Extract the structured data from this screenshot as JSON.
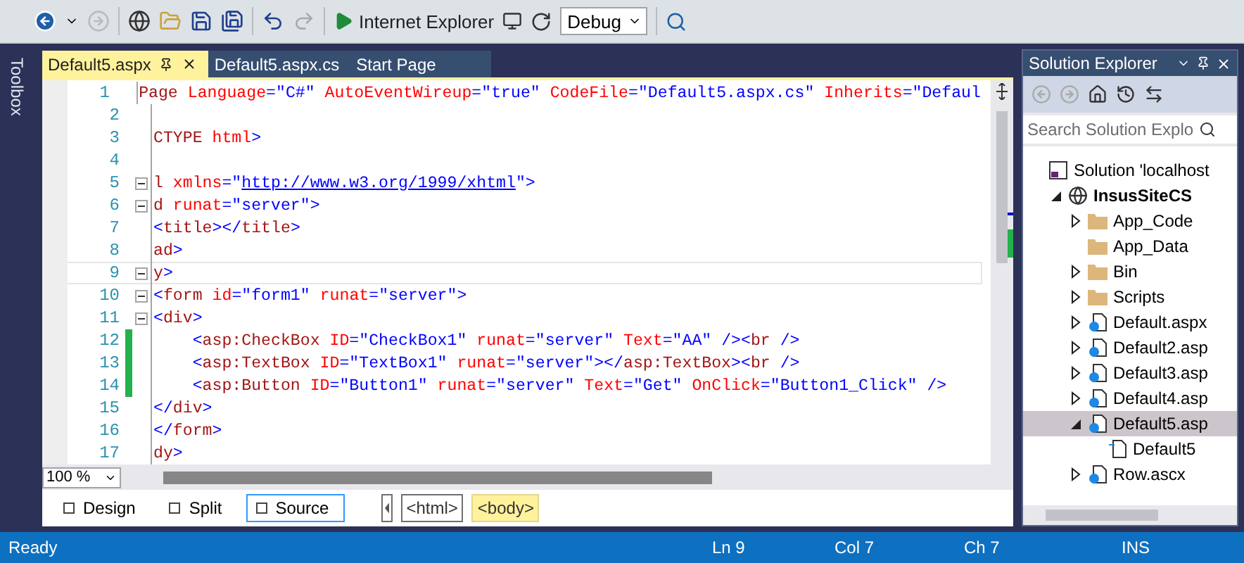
{
  "toolbar": {
    "browser": "Internet Explorer",
    "configuration": "Debug"
  },
  "toolbox": {
    "label": "Toolbox"
  },
  "tabs": [
    {
      "label": "Default5.aspx",
      "selected": true
    },
    {
      "label": "Default5.aspx.cs",
      "selected": false
    },
    {
      "label": "Start Page",
      "selected": false
    }
  ],
  "editor": {
    "zoom": "100 %",
    "lines": [
      {
        "number": "1",
        "fold": false,
        "changed": false,
        "current": false,
        "tokens": [
          {
            "kind": "tag",
            "text": "Page"
          },
          {
            "kind": "attr",
            "text": " Language"
          },
          {
            "kind": "value",
            "text": "=\"C#\""
          },
          {
            "kind": "attr",
            "text": " AutoEventWireup"
          },
          {
            "kind": "value",
            "text": "=\"true\""
          },
          {
            "kind": "attr",
            "text": " CodeFile"
          },
          {
            "kind": "value",
            "text": "=\"Default5.aspx.cs\""
          },
          {
            "kind": "attr",
            "text": " Inherits"
          },
          {
            "kind": "value",
            "text": "=\"Defaul"
          }
        ]
      },
      {
        "number": "2",
        "fold": false,
        "changed": false,
        "current": false
      },
      {
        "number": "3",
        "fold": false,
        "changed": false,
        "current": false,
        "tokens": [
          {
            "kind": "tag",
            "text": "CTYPE"
          },
          {
            "kind": "attr",
            "text": " html"
          },
          {
            "kind": "punct",
            "text": ">"
          }
        ]
      },
      {
        "number": "4",
        "fold": false,
        "changed": false,
        "current": false
      },
      {
        "number": "5",
        "fold": true,
        "changed": false,
        "current": false,
        "tokens": [
          {
            "kind": "tag",
            "text": "l"
          },
          {
            "kind": "attr",
            "text": " xmlns"
          },
          {
            "kind": "value",
            "text": "=\""
          },
          {
            "kind": "link",
            "text": "http://www.w3.org/1999/xhtml"
          },
          {
            "kind": "value",
            "text": "\">"
          }
        ]
      },
      {
        "number": "6",
        "fold": true,
        "changed": false,
        "current": false,
        "tokens": [
          {
            "kind": "tag",
            "text": "d"
          },
          {
            "kind": "attr",
            "text": " runat"
          },
          {
            "kind": "value",
            "text": "=\"server\">"
          }
        ]
      },
      {
        "number": "7",
        "fold": false,
        "changed": false,
        "current": false,
        "tokens": [
          {
            "kind": "punct",
            "text": "<"
          },
          {
            "kind": "tag",
            "text": "title"
          },
          {
            "kind": "punct",
            "text": "></"
          },
          {
            "kind": "tag",
            "text": "title"
          },
          {
            "kind": "punct",
            "text": ">"
          }
        ]
      },
      {
        "number": "8",
        "fold": false,
        "changed": false,
        "current": false,
        "tokens": [
          {
            "kind": "tag",
            "text": "ad"
          },
          {
            "kind": "punct",
            "text": ">"
          }
        ]
      },
      {
        "number": "9",
        "fold": true,
        "changed": false,
        "current": true,
        "tokens": [
          {
            "kind": "tag",
            "text": "y"
          },
          {
            "kind": "punct",
            "text": ">"
          }
        ]
      },
      {
        "number": "10",
        "fold": true,
        "changed": false,
        "current": false,
        "tokens": [
          {
            "kind": "punct",
            "text": "<"
          },
          {
            "kind": "tag",
            "text": "form"
          },
          {
            "kind": "attr",
            "text": " id"
          },
          {
            "kind": "value",
            "text": "=\"form1\""
          },
          {
            "kind": "attr",
            "text": " runat"
          },
          {
            "kind": "value",
            "text": "=\"server\">"
          }
        ]
      },
      {
        "number": "11",
        "fold": true,
        "changed": false,
        "current": false,
        "tokens": [
          {
            "kind": "punct",
            "text": "<"
          },
          {
            "kind": "tag",
            "text": "div"
          },
          {
            "kind": "punct",
            "text": ">"
          }
        ]
      },
      {
        "number": "12",
        "fold": false,
        "changed": true,
        "current": false,
        "tokens": [
          {
            "kind": "punct",
            "text": "    <"
          },
          {
            "kind": "tag",
            "text": "asp:CheckBox"
          },
          {
            "kind": "attr",
            "text": " ID"
          },
          {
            "kind": "value",
            "text": "=\"CheckBox1\""
          },
          {
            "kind": "attr",
            "text": " runat"
          },
          {
            "kind": "value",
            "text": "=\"server\""
          },
          {
            "kind": "attr",
            "text": " Text"
          },
          {
            "kind": "value",
            "text": "=\"AA\" /><"
          },
          {
            "kind": "tag",
            "text": "br"
          },
          {
            "kind": "punct",
            "text": " />"
          }
        ]
      },
      {
        "number": "13",
        "fold": false,
        "changed": true,
        "current": false,
        "tokens": [
          {
            "kind": "punct",
            "text": "    <"
          },
          {
            "kind": "tag",
            "text": "asp:TextBox"
          },
          {
            "kind": "attr",
            "text": " ID"
          },
          {
            "kind": "value",
            "text": "=\"TextBox1\""
          },
          {
            "kind": "attr",
            "text": " runat"
          },
          {
            "kind": "value",
            "text": "=\"server\"></"
          },
          {
            "kind": "tag",
            "text": "asp:TextBox"
          },
          {
            "kind": "punct",
            "text": "><"
          },
          {
            "kind": "tag",
            "text": "br"
          },
          {
            "kind": "punct",
            "text": " />"
          }
        ]
      },
      {
        "number": "14",
        "fold": false,
        "changed": true,
        "current": false,
        "tokens": [
          {
            "kind": "punct",
            "text": "    <"
          },
          {
            "kind": "tag",
            "text": "asp:Button"
          },
          {
            "kind": "attr",
            "text": " ID"
          },
          {
            "kind": "value",
            "text": "=\"Button1\""
          },
          {
            "kind": "attr",
            "text": " runat"
          },
          {
            "kind": "value",
            "text": "=\"server\""
          },
          {
            "kind": "attr",
            "text": " Text"
          },
          {
            "kind": "value",
            "text": "=\"Get\""
          },
          {
            "kind": "attr",
            "text": " OnClick"
          },
          {
            "kind": "value",
            "text": "=\"Button1_Click\""
          },
          {
            "kind": "punct",
            "text": " />"
          }
        ]
      },
      {
        "number": "15",
        "fold": false,
        "changed": false,
        "current": false,
        "tokens": [
          {
            "kind": "punct",
            "text": "</"
          },
          {
            "kind": "tag",
            "text": "div"
          },
          {
            "kind": "punct",
            "text": ">"
          }
        ]
      },
      {
        "number": "16",
        "fold": false,
        "changed": false,
        "current": false,
        "tokens": [
          {
            "kind": "punct",
            "text": "</"
          },
          {
            "kind": "tag",
            "text": "form"
          },
          {
            "kind": "punct",
            "text": ">"
          }
        ]
      },
      {
        "number": "17",
        "fold": false,
        "changed": false,
        "current": false,
        "tokens": [
          {
            "kind": "tag",
            "text": "dy"
          },
          {
            "kind": "punct",
            "text": ">"
          }
        ]
      }
    ]
  },
  "view_tabs": [
    {
      "label": "Design",
      "selected": false
    },
    {
      "label": "Split",
      "selected": false
    },
    {
      "label": "Source",
      "selected": true
    }
  ],
  "breadcrumbs": [
    {
      "label": "<html>",
      "selected": false
    },
    {
      "label": "<body>",
      "selected": true
    }
  ],
  "solution_explorer": {
    "title": "Solution Explorer",
    "search": {
      "placeholder": "Search Solution Explo"
    },
    "tree": [
      {
        "label": "Solution 'localhost",
        "kind": "solution",
        "selected": false,
        "children": [
          {
            "label": "InsusSiteCS",
            "kind": "project",
            "expanded": true,
            "selected": false,
            "children": [
              {
                "label": "App_Code",
                "kind": "folder",
                "expanded": false,
                "selected": false
              },
              {
                "label": "App_Data",
                "kind": "folder",
                "selected": false
              },
              {
                "label": "Bin",
                "kind": "folder",
                "expanded": false,
                "selected": false
              },
              {
                "label": "Scripts",
                "kind": "folder",
                "expanded": false,
                "selected": false
              },
              {
                "label": "Default.aspx",
                "kind": "page",
                "expanded": false,
                "selected": false
              },
              {
                "label": "Default2.asp",
                "kind": "page",
                "expanded": false,
                "selected": false
              },
              {
                "label": "Default3.asp",
                "kind": "page",
                "expanded": false,
                "selected": false
              },
              {
                "label": "Default4.asp",
                "kind": "page",
                "expanded": false,
                "selected": false
              },
              {
                "label": "Default5.asp",
                "kind": "page",
                "expanded": true,
                "selected": true,
                "children": [
                  {
                    "label": "Default5",
                    "kind": "code",
                    "selected": false
                  }
                ]
              },
              {
                "label": "Row.ascx",
                "kind": "page",
                "expanded": false,
                "selected": false
              }
            ]
          }
        ]
      }
    ]
  },
  "status_bar": [
    {
      "text": "Ready"
    },
    {
      "text": "Ln 9"
    },
    {
      "text": "Col 7"
    },
    {
      "text": "Ch 7"
    },
    {
      "text": "INS"
    }
  ]
}
